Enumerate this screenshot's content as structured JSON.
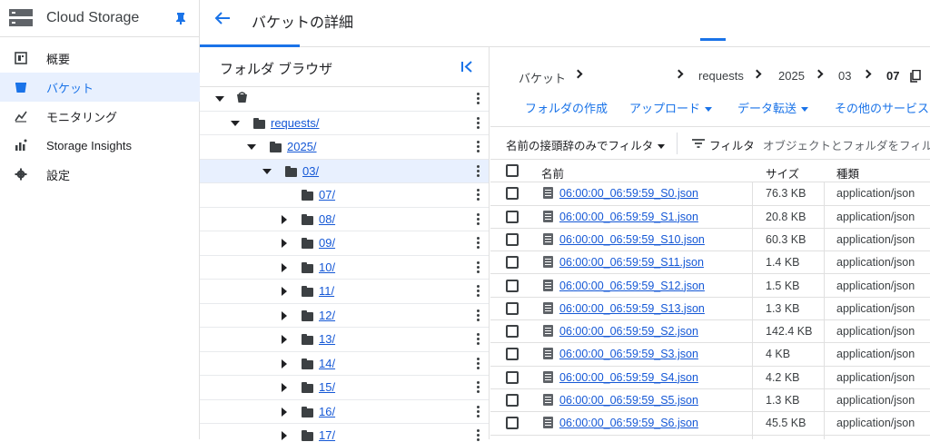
{
  "product": {
    "title": "Cloud Storage"
  },
  "nav": {
    "items": [
      {
        "label": "概要",
        "icon": "dashboard-icon"
      },
      {
        "label": "バケット",
        "icon": "bucket-icon",
        "active": true
      },
      {
        "label": "モニタリング",
        "icon": "monitoring-icon"
      },
      {
        "label": "Storage Insights",
        "icon": "insights-icon"
      },
      {
        "label": "設定",
        "icon": "gear-icon"
      }
    ]
  },
  "header": {
    "title": "バケットの詳細"
  },
  "tree": {
    "title": "フォルダ ブラウザ",
    "root": "requests/",
    "year": "2025/",
    "month": "03/",
    "days": [
      "07/",
      "08/",
      "09/",
      "10/",
      "11/",
      "12/",
      "13/",
      "14/",
      "15/",
      "16/",
      "17/"
    ]
  },
  "breadcrumb": [
    "バケット",
    "requests",
    "2025",
    "03",
    "07"
  ],
  "actions": {
    "create_folder": "フォルダの作成",
    "upload": "アップロード",
    "transfer": "データ転送",
    "other": "その他のサービス"
  },
  "filter": {
    "prefix_label": "名前の接頭辞のみでフィルタ",
    "filter_label": "フィルタ",
    "placeholder": "オブジェクトとフォルダをフィル"
  },
  "columns": {
    "name": "名前",
    "size": "サイズ",
    "type": "種類"
  },
  "files": [
    {
      "name": "06:00:00_06:59:59_S0.json",
      "size": "76.3 KB",
      "type": "application/json"
    },
    {
      "name": "06:00:00_06:59:59_S1.json",
      "size": "20.8 KB",
      "type": "application/json"
    },
    {
      "name": "06:00:00_06:59:59_S10.json",
      "size": "60.3 KB",
      "type": "application/json"
    },
    {
      "name": "06:00:00_06:59:59_S11.json",
      "size": "1.4 KB",
      "type": "application/json"
    },
    {
      "name": "06:00:00_06:59:59_S12.json",
      "size": "1.5 KB",
      "type": "application/json"
    },
    {
      "name": "06:00:00_06:59:59_S13.json",
      "size": "1.3 KB",
      "type": "application/json"
    },
    {
      "name": "06:00:00_06:59:59_S2.json",
      "size": "142.4 KB",
      "type": "application/json"
    },
    {
      "name": "06:00:00_06:59:59_S3.json",
      "size": "4 KB",
      "type": "application/json"
    },
    {
      "name": "06:00:00_06:59:59_S4.json",
      "size": "4.2 KB",
      "type": "application/json"
    },
    {
      "name": "06:00:00_06:59:59_S5.json",
      "size": "1.3 KB",
      "type": "application/json"
    },
    {
      "name": "06:00:00_06:59:59_S6.json",
      "size": "45.5 KB",
      "type": "application/json"
    }
  ],
  "colors": {
    "accent": "#1a73e8",
    "link": "#1558d6",
    "selected_bg": "#e8f0fe"
  }
}
